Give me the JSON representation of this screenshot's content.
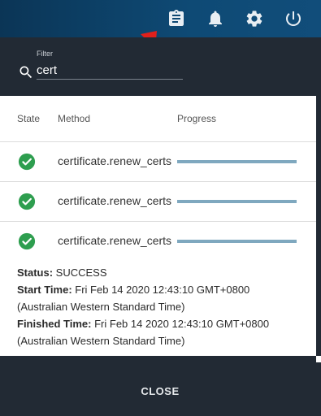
{
  "topbar": {
    "icons": [
      "clipboard-icon",
      "bell-icon",
      "gear-icon",
      "power-icon"
    ],
    "background": "#0e4a75"
  },
  "filter": {
    "label": "Filter",
    "value": "cert"
  },
  "table": {
    "headers": {
      "state": "State",
      "method": "Method",
      "progress": "Progress"
    },
    "rows": [
      {
        "state": "success",
        "method": "certificate.renew_certs",
        "progress": 1.0
      },
      {
        "state": "success",
        "method": "certificate.renew_certs",
        "progress": 1.0
      },
      {
        "state": "success",
        "method": "certificate.renew_certs",
        "progress": 1.0
      }
    ]
  },
  "details": {
    "status_label": "Status:",
    "status_value": " SUCCESS",
    "start_label": "Start Time:",
    "start_value": " Fri Feb 14 2020 12:43:10 GMT+0800",
    "start_tz": "(Australian Western Standard Time)",
    "finished_label": "Finished Time:",
    "finished_value": " Fri Feb 14 2020 12:43:10 GMT+0800",
    "finished_tz": "(Australian Western Standard Time)"
  },
  "footer": {
    "close_label": "CLOSE"
  },
  "colors": {
    "success": "#2e9e4f",
    "progress": "#7fa8bf",
    "arrow": "#e0201b"
  }
}
